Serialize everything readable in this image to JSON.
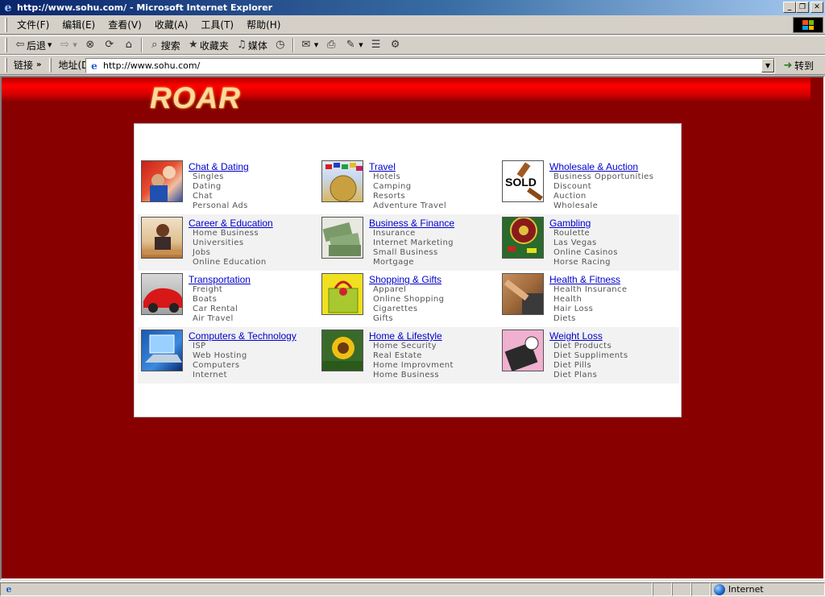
{
  "window": {
    "title": "http://www.sohu.com/ - Microsoft Internet Explorer",
    "minimize": "_",
    "restore": "❐",
    "close": "✕"
  },
  "menu": [
    "文件(F)",
    "编辑(E)",
    "查看(V)",
    "收藏(A)",
    "工具(T)",
    "帮助(H)"
  ],
  "toolbar": {
    "back": "后退",
    "search": "搜索",
    "favorites": "收藏夹",
    "media": "媒体"
  },
  "address": {
    "links_label": "链接",
    "address_label": "地址(D)",
    "url": "http://www.sohu.com/",
    "go_label": "转到"
  },
  "page": {
    "logo": "ROAR",
    "categories": [
      {
        "title": "Chat & Dating",
        "subs": [
          "Singles",
          "Dating",
          "Chat",
          "Personal Ads"
        ]
      },
      {
        "title": "Travel",
        "subs": [
          "Hotels",
          "Camping",
          "Resorts",
          "Adventure Travel"
        ]
      },
      {
        "title": "Wholesale & Auction",
        "subs": [
          "Business Opportunities",
          "Discount",
          "Auction",
          "Wholesale"
        ],
        "thumb_text": "SOLD"
      },
      {
        "title": "Career & Education",
        "subs": [
          "Home Business",
          "Universities",
          "Jobs",
          "Online Education"
        ]
      },
      {
        "title": "Business & Finance",
        "subs": [
          "Insurance",
          "Internet Marketing",
          "Small Business",
          "Mortgage"
        ]
      },
      {
        "title": "Gambling",
        "subs": [
          "Roulette",
          "Las Vegas",
          "Online Casinos",
          "Horse Racing"
        ]
      },
      {
        "title": "Transportation",
        "subs": [
          "Freight",
          "Boats",
          "Car Rental",
          "Air Travel"
        ]
      },
      {
        "title": "Shopping & Gifts",
        "subs": [
          "Apparel",
          "Online Shopping",
          "Cigarettes",
          "Gifts"
        ]
      },
      {
        "title": "Health & Fitness",
        "subs": [
          "Health Insurance",
          "Health",
          "Hair Loss",
          "Diets"
        ]
      },
      {
        "title": "Computers & Technology",
        "subs": [
          "ISP",
          "Web Hosting",
          "Computers",
          "Internet"
        ]
      },
      {
        "title": "Home & Lifestyle",
        "subs": [
          "Home Security",
          "Real Estate",
          "Home Improvment",
          "Home Business"
        ]
      },
      {
        "title": "Weight Loss",
        "subs": [
          "Diet Products",
          "Diet Suppliments",
          "Diet Pills",
          "Diet Plans"
        ]
      }
    ]
  },
  "status": {
    "zone": "Internet"
  },
  "colors": {
    "page_background": "#880000",
    "link": "#0000cc",
    "sub_text": "#555555"
  }
}
